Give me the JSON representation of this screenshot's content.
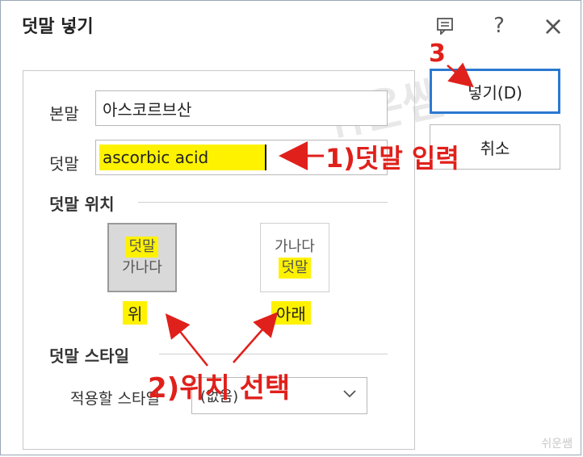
{
  "window": {
    "title": "덧말 넣기",
    "icons": [
      "note-icon",
      "help-icon",
      "close-icon"
    ],
    "help_glyph": "?",
    "close_glyph": "×"
  },
  "form": {
    "base_text_label": "본말",
    "base_text_value": "아스코르브산",
    "ruby_text_label": "덧말",
    "ruby_text_value": "ascorbic acid"
  },
  "position": {
    "section_title": "덧말 위치",
    "options": [
      {
        "line1": "덧말",
        "line2": "가나다",
        "label": "위",
        "selected": true
      },
      {
        "line1": "가나다",
        "line2": "덧말",
        "label": "아래",
        "selected": false
      }
    ]
  },
  "style": {
    "section_title": "덧말 스타일",
    "apply_label": "적용할 스타일",
    "apply_value": "(없음)"
  },
  "buttons": {
    "insert_label": "넣기(D)",
    "cancel_label": "취소"
  },
  "annotations": {
    "step1": "1)덧말 입력",
    "step2": "2)위치 선택",
    "step3": "3"
  },
  "colors": {
    "highlight": "#fff200",
    "annotation_red": "#e0201b",
    "primary_border": "#2b79d1"
  },
  "watermark": "쉬운쌤"
}
